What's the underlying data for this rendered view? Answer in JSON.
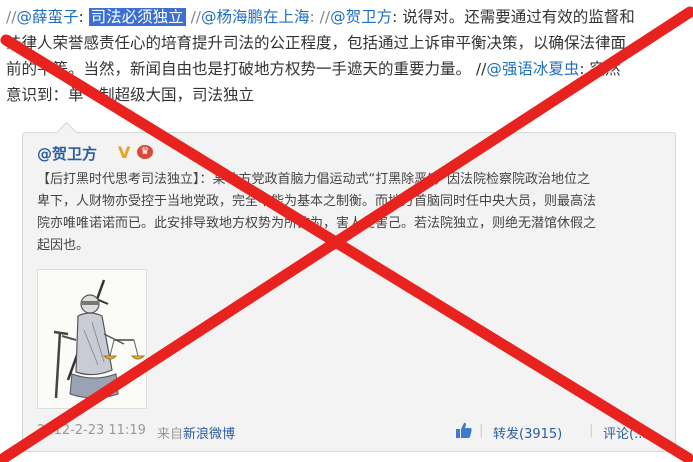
{
  "post": {
    "line1": [
      {
        "text": "//",
        "kind": "sep"
      },
      {
        "text": "@薛蛮子",
        "kind": "link"
      },
      {
        "text": ": ",
        "kind": "plain"
      },
      {
        "text": "司法必须独立",
        "kind": "hl"
      },
      {
        "text": " //",
        "kind": "sep"
      },
      {
        "text": "@杨海鹏在上海",
        "kind": "link"
      },
      {
        "text": ": //",
        "kind": "sep"
      },
      {
        "text": "@贺卫方",
        "kind": "link"
      },
      {
        "text": ": 说得对。还需要通过有效的监督和",
        "kind": "plain"
      }
    ],
    "line2": "法律人荣誉感责任心的培育提升司法的公正程度，包括通过上诉审平衡决策，以确保法律面",
    "line3_a": "前的平等。当然，新闻自由也是打破地方权势一手遮天的重要力量。 //",
    "line3_link": "@强语冰夏虫",
    "line3_b": ": 突然",
    "line4": "意识到：单一制超级大国，司法独立"
  },
  "quote": {
    "author": "@贺卫方",
    "verified": "V",
    "crown": "♛",
    "lines": [
      "【后打黑时代思考司法独立】：某地方党政首脑力倡运动式“打黑除恶”，因法院检察院政治地位之",
      "卑下，人财物亦受控于当地党政，完全不能为基本之制衡。而地方首脑同时任中央大员，则最高法",
      "院亦唯唯诺诺而已。此安排导致地方权势为所欲为，害人复害己。若法院独立，则绝无潜馆休假之",
      "起因也。"
    ],
    "image_alt": "justice-statue-thumbnail",
    "footer": {
      "time": "2012-2-23 11:19",
      "via_prefix": "来自",
      "via_source": "新浪微博",
      "pipe": "|",
      "forward": "转发(3915)",
      "comment": "评论(..."
    }
  },
  "colors": {
    "link": "#1f6fbf",
    "highlight": "#3b6fd4",
    "cross": "#e8231f"
  }
}
